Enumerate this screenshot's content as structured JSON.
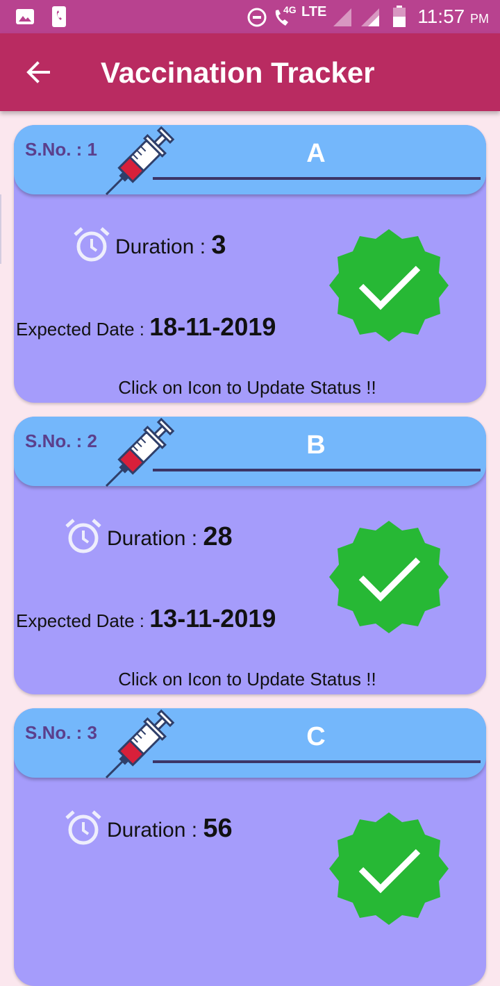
{
  "status_bar": {
    "time": "11:57",
    "ampm": "PM",
    "network": "4G",
    "lte": "LTE"
  },
  "app_bar": {
    "title": "Vaccination Tracker",
    "back_icon": "arrow-left-icon"
  },
  "colors": {
    "status_bar": "#b8428f",
    "app_bar": "#b92b61",
    "page_bg": "#fbe7ee",
    "card_body": "#a59cfb",
    "card_header": "#74b7fb",
    "badge_green": "#27b835"
  },
  "cards": [
    {
      "sno": "S.No. : 1",
      "name": "A",
      "duration_label": "Duration : ",
      "duration_value": "3",
      "expected_label": "Expected Date : ",
      "expected_value": "18-11-2019",
      "hint": "Click on Icon to Update Status !!"
    },
    {
      "sno": "S.No. : 2",
      "name": "B",
      "duration_label": "Duration : ",
      "duration_value": "28",
      "expected_label": "Expected Date : ",
      "expected_value": "13-11-2019",
      "hint": "Click on Icon to Update Status !!"
    },
    {
      "sno": "S.No. : 3",
      "name": "C",
      "duration_label": "Duration : ",
      "duration_value": "56",
      "expected_label": "",
      "expected_value": "",
      "hint": ""
    }
  ]
}
